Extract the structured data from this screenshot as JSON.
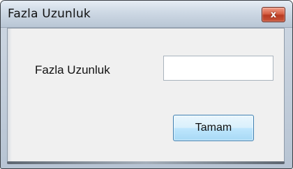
{
  "window": {
    "title": "Fazla Uzunluk",
    "close_label": "x"
  },
  "form": {
    "label": "Fazla Uzunluk",
    "input_value": ""
  },
  "buttons": {
    "ok_label": "Tamam"
  },
  "colors": {
    "close_button": "#c9553a",
    "ok_button_border": "#3c7fb1",
    "client_background": "#f0f0f0"
  },
  "icons": {
    "close": "close-icon"
  }
}
